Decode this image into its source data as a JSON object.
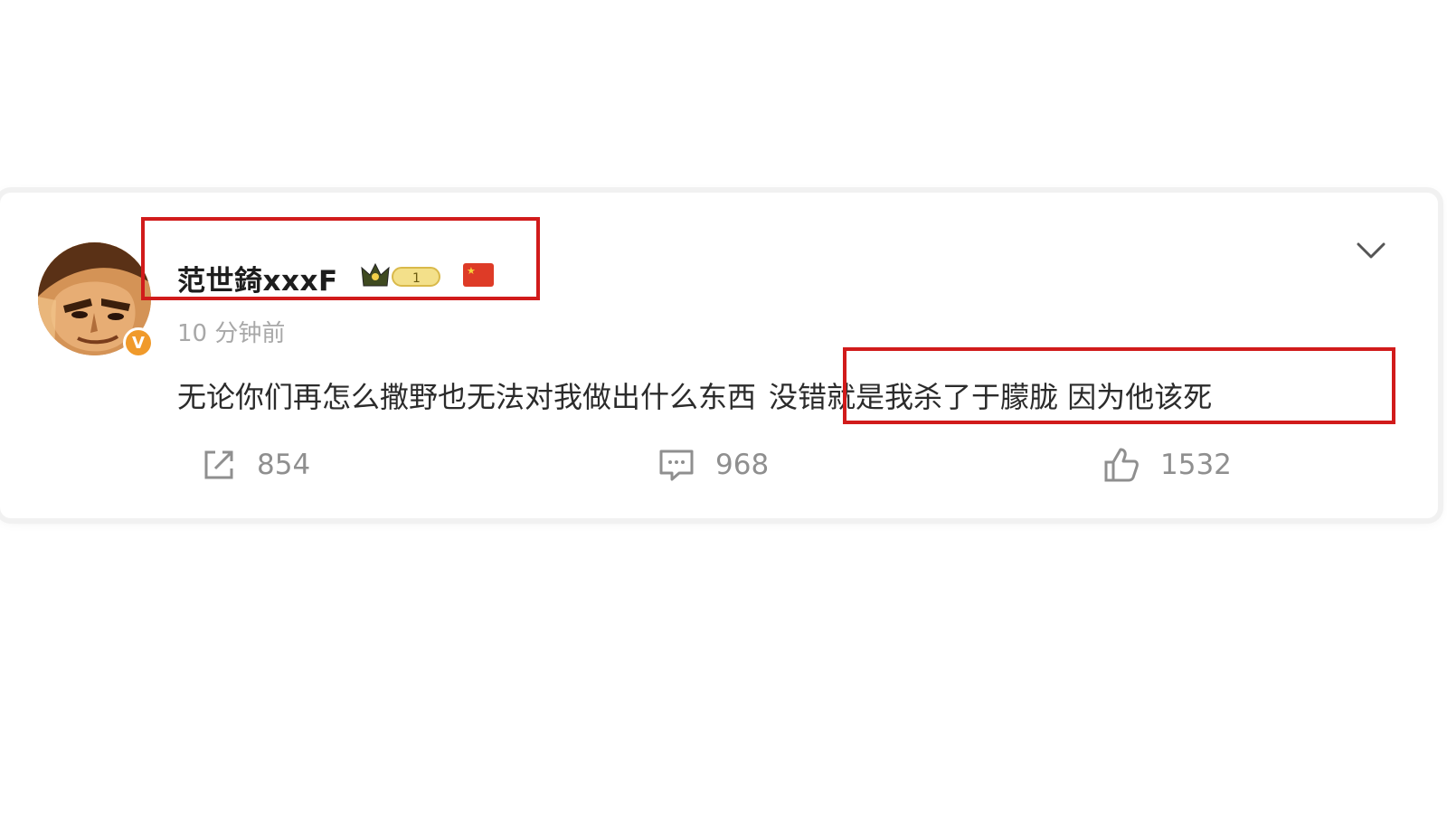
{
  "post": {
    "username": "范世錡xxxF",
    "level_badge": "1",
    "verified_badge": "V",
    "timestamp": "10 分钟前",
    "text_part1": "无论你们再怎么撒野也无法对我做出什么东西",
    "text_part2": "没错就是我杀了于朦胧 因为他该死"
  },
  "actions": {
    "share_count": "854",
    "comment_count": "968",
    "like_count": "1532"
  },
  "icons": {
    "share": "share-icon",
    "comment": "comment-icon",
    "like": "thumbs-up-icon",
    "expand": "chevron-down-icon"
  },
  "colors": {
    "highlight_box": "#d11b1b",
    "verified_badge": "#f09a2b",
    "muted_text": "#8f8f8f"
  }
}
